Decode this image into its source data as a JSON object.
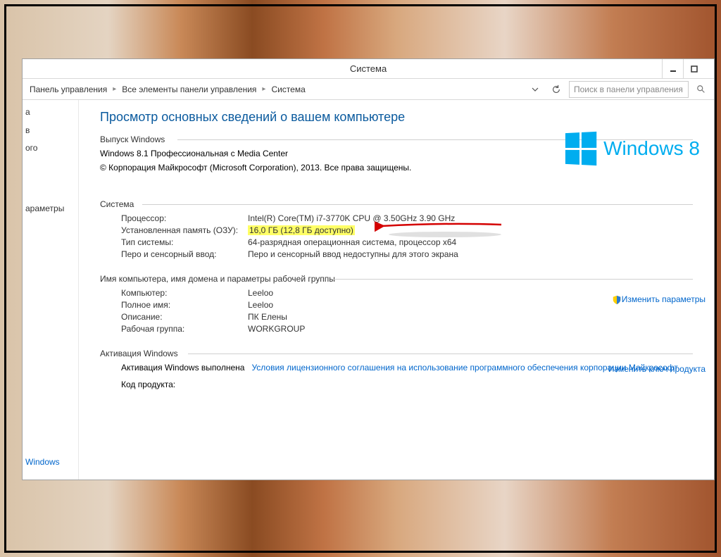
{
  "window": {
    "title": "Система"
  },
  "breadcrumb": {
    "items": [
      "Панель управления",
      "Все элементы панели управления",
      "Система"
    ]
  },
  "search": {
    "placeholder": "Поиск в панели управления"
  },
  "sidebar": {
    "top": [
      "а",
      "в",
      "ого"
    ],
    "params_label": "араметры",
    "bottom": "Windows"
  },
  "page": {
    "title": "Просмотр основных сведений о вашем компьютере"
  },
  "edition": {
    "header": "Выпуск Windows",
    "name": "Windows 8.1 Профессиональная с Media Center",
    "copyright": "© Корпорация Майкрософт (Microsoft Corporation), 2013. Все права защищены."
  },
  "logo_text": "Windows 8",
  "system": {
    "header": "Система",
    "rows": {
      "processor": {
        "label": "Процессор:",
        "value": "Intel(R) Core(TM) i7-3770K CPU @ 3.50GHz   3.90 GHz"
      },
      "ram": {
        "label": "Установленная память (ОЗУ):",
        "value": "16,0 ГБ (12,8 ГБ доступно)"
      },
      "type": {
        "label": "Тип системы:",
        "value": "64-разрядная операционная система, процессор x64"
      },
      "pen": {
        "label": "Перо и сенсорный ввод:",
        "value": "Перо и сенсорный ввод недоступны для этого экрана"
      }
    }
  },
  "computer": {
    "header": "Имя компьютера, имя домена и параметры рабочей группы",
    "rows": {
      "computer": {
        "label": "Компьютер:",
        "value": "Leeloo"
      },
      "fullname": {
        "label": "Полное имя:",
        "value": "Leeloo"
      },
      "description": {
        "label": "Описание:",
        "value": "ПК Елены"
      },
      "workgroup": {
        "label": "Рабочая группа:",
        "value": "WORKGROUP"
      }
    },
    "change_link": "Изменить параметры"
  },
  "activation": {
    "header": "Активация Windows",
    "status_label": "Активация Windows выполнена",
    "license_link": "Условия лицензионного соглашения на использование программного обеспечения корпорации Майкрософт",
    "product_key_label": "Код продукта:",
    "change_key_link": "Изменить ключ продукта"
  }
}
